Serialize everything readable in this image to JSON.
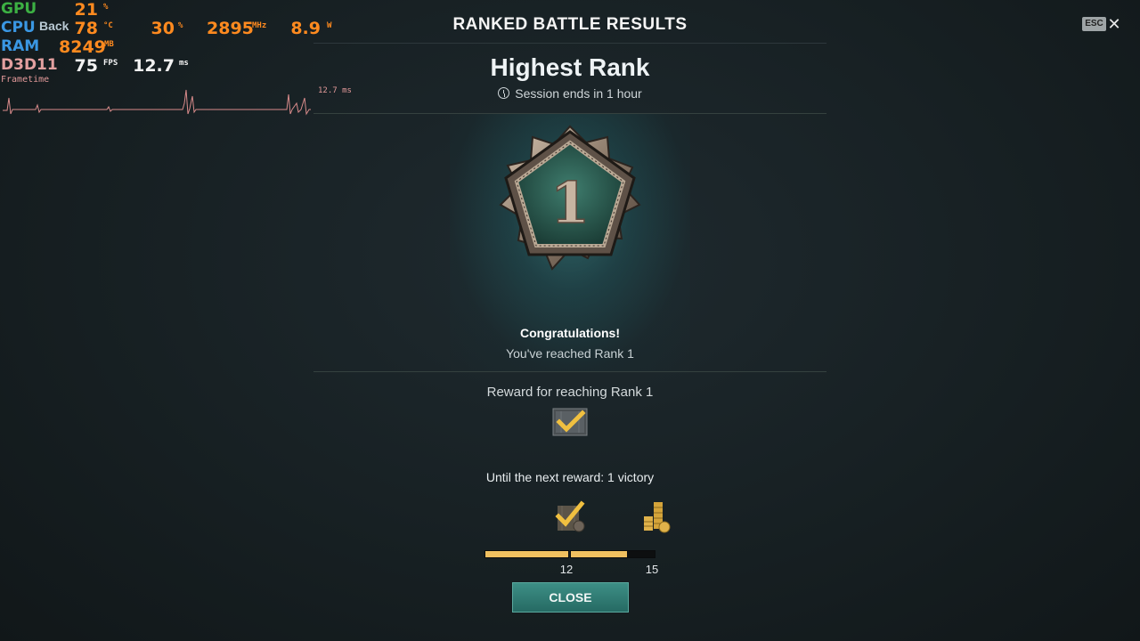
{
  "overlay": {
    "gpu": {
      "label": "GPU",
      "load": "21",
      "load_unit": "%"
    },
    "cpu": {
      "label": "CPU",
      "temp": "78",
      "temp_unit": "°C",
      "usage": "30",
      "usage_unit": "%",
      "clock": "2895",
      "clock_unit": "MHz",
      "power": "8.9",
      "power_unit": "W"
    },
    "ram": {
      "label": "RAM",
      "value": "8249",
      "unit": "MB"
    },
    "api": {
      "label": "D3D11",
      "fps": "75",
      "fps_unit": "FPS",
      "frametime": "12.7",
      "frametime_unit": "ms"
    },
    "frametime_label": "Frametime",
    "frametime_readout": "12.7 ms"
  },
  "back_label": "Back",
  "header": {
    "title": "RANKED BATTLE RESULTS",
    "esc_label": "ESC",
    "close_symbol": "✕"
  },
  "rank": {
    "title": "Highest Rank",
    "session": "Session ends in 1 hour",
    "number": "1"
  },
  "message": {
    "congrats": "Congratulations!",
    "reached": "You've reached Rank 1"
  },
  "reward": {
    "title": "Reward for reaching Rank 1"
  },
  "next": {
    "text": "Until the next reward: 1 victory"
  },
  "progress": {
    "current_tick": "12",
    "target_tick": "15",
    "segment1_fill": 1.0,
    "segment2_fill": 0.67
  },
  "close_button": "CLOSE",
  "colors": {
    "accent": "#f0c060",
    "button": "#2f7d74",
    "osd_orange": "#ff8a1f"
  }
}
